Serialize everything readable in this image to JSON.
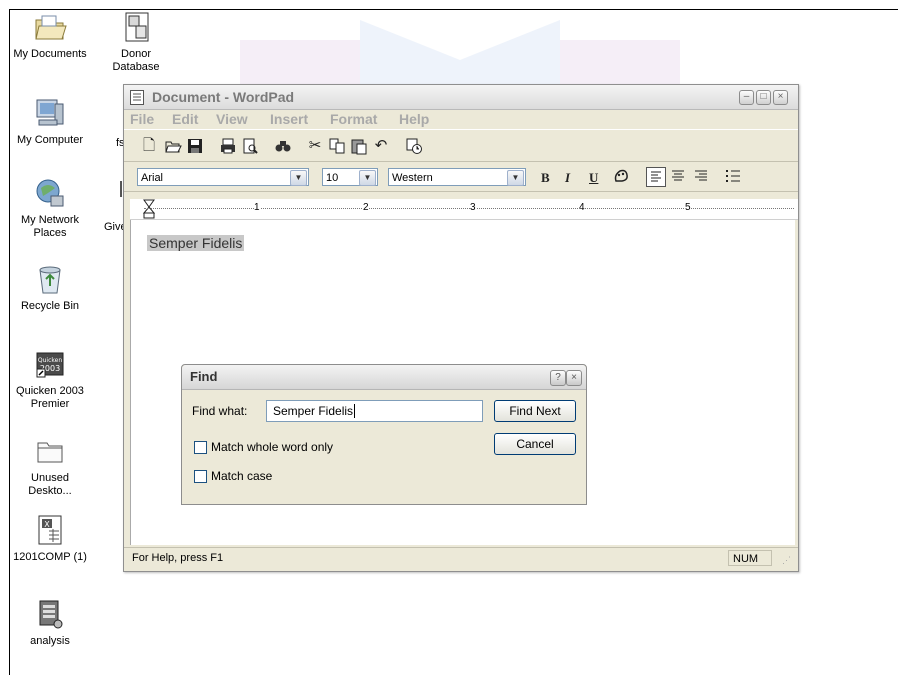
{
  "desktop": {
    "icons": [
      {
        "label": "My Documents",
        "icon": "folder-icon"
      },
      {
        "label": "Donor Database",
        "icon": "database-file-icon"
      },
      {
        "label": "My Computer",
        "icon": "computer-icon"
      },
      {
        "label": "My Network Places",
        "icon": "network-icon"
      },
      {
        "label": "Recycle Bin",
        "icon": "recycle-bin-icon"
      },
      {
        "label": "Quicken 2003 Premier",
        "icon": "quicken-icon"
      },
      {
        "label": "Unused Deskto...",
        "icon": "folder-icon"
      },
      {
        "label": "1201COMP (1)",
        "icon": "spreadsheet-icon"
      },
      {
        "label": "analysis",
        "icon": "server-file-icon"
      }
    ],
    "partial_labels": [
      "fs",
      "Give"
    ]
  },
  "wordpad": {
    "title": "Document - WordPad",
    "menu": [
      "File",
      "Edit",
      "View",
      "Insert",
      "Format",
      "Help"
    ],
    "toolbar_icons": [
      "new-icon",
      "open-icon",
      "save-icon",
      "print-icon",
      "print-preview-icon",
      "find-icon",
      "cut-icon",
      "copy-icon",
      "paste-icon",
      "undo-icon",
      "date-time-icon"
    ],
    "font": "Arial",
    "font_size": "10",
    "script": "Western",
    "format_buttons": [
      "B",
      "I",
      "U"
    ],
    "ruler_numbers": [
      "1",
      "2",
      "3",
      "4",
      "5"
    ],
    "document_text": "Semper Fidelis",
    "status_help": "For Help, press F1",
    "status_num": "NUM"
  },
  "find_dialog": {
    "title": "Find",
    "find_what_label": "Find what:",
    "find_what_value": "Semper Fidelis",
    "find_next_label": "Find Next",
    "cancel_label": "Cancel",
    "match_whole_word_label": "Match whole word only",
    "match_case_label": "Match case",
    "match_whole_word_checked": false,
    "match_case_checked": false
  }
}
